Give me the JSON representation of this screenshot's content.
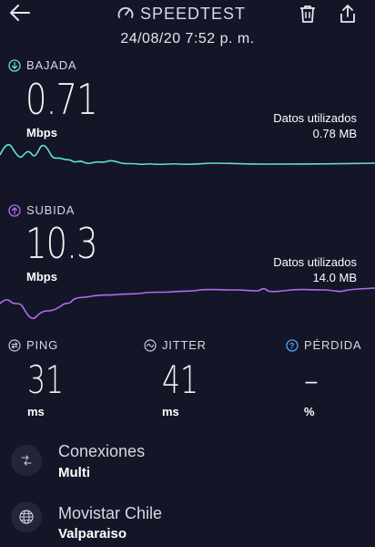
{
  "header": {
    "app_title": "SPEEDTEST",
    "datetime": "24/08/20 7:52 p. m."
  },
  "download": {
    "label": "BAJADA",
    "value": "0.71",
    "unit": "Mbps",
    "data_used_label": "Datos utilizados",
    "data_used_value": "0.78 MB",
    "color": "#5fe0d2"
  },
  "upload": {
    "label": "SUBIDA",
    "value": "10.3",
    "unit": "Mbps",
    "data_used_label": "Datos utilizados",
    "data_used_value": "14.0 MB",
    "color": "#b06cf0"
  },
  "stats": {
    "ping": {
      "label": "PING",
      "value": "31",
      "unit": "ms"
    },
    "jitter": {
      "label": "JITTER",
      "value": "41",
      "unit": "ms"
    },
    "loss": {
      "label": "PÉRDIDA",
      "value": "–",
      "unit": "%"
    }
  },
  "connections": {
    "title": "Conexiones",
    "value": "Multi"
  },
  "provider": {
    "name": "Movistar Chile",
    "location": "Valparaiso"
  },
  "colors": {
    "background": "#141526",
    "accent_download": "#5fe0d2",
    "accent_upload": "#b06cf0",
    "accent_info": "#4aa3ff"
  }
}
